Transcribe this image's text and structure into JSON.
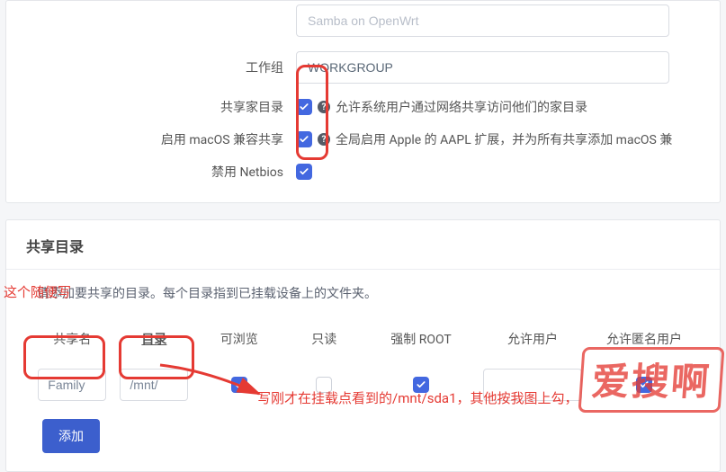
{
  "top": {
    "input_top_value": "Samba on OpenWrt",
    "workgroup_label": "工作组",
    "workgroup_value": "WORKGROUP",
    "share_home_label": "共享家目录",
    "share_home_desc": "允许系统用户通过网络共享访问他们的家目录",
    "macos_label": "启用 macOS 兼容共享",
    "macos_desc": "全局启用 Apple 的 AAPL 扩展，并为所有共享添加 macOS 兼",
    "netbios_label": "禁用 Netbios"
  },
  "section": {
    "title": "共享目录",
    "desc": "请添加要共享的目录。每个目录指到已挂载设备上的文件夹。",
    "headers": {
      "share": "共享名",
      "dir": "目录",
      "browse": "可浏览",
      "ro": "只读",
      "root": "强制 ROOT",
      "users": "允许用户",
      "anon": "允许匿名用户"
    },
    "row": {
      "share": "Family",
      "dir": "/mnt/"
    },
    "add_label": "添加"
  },
  "annotations": {
    "note1": "这个随便写",
    "note2": "写刚才在挂载点看到的/mnt/sda1，其他按我图上勾，",
    "watermark": "爱搜啊"
  }
}
